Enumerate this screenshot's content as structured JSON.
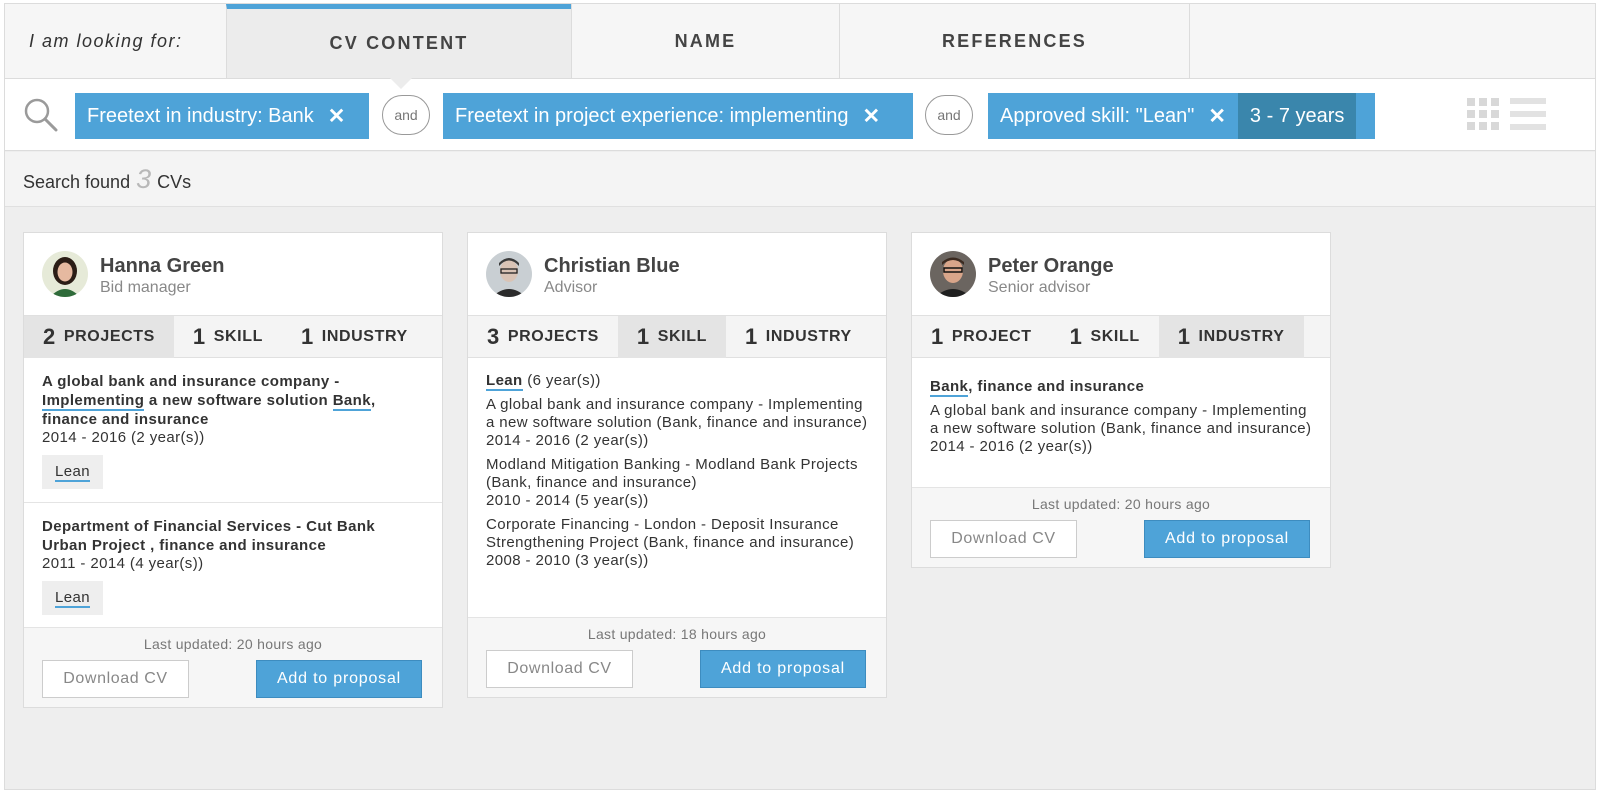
{
  "header": {
    "looking_for": "I am looking for:",
    "tabs": [
      {
        "label": "CV CONTENT",
        "active": true
      },
      {
        "label": "NAME",
        "active": false
      },
      {
        "label": "REFERENCES",
        "active": false
      }
    ]
  },
  "filters": {
    "chips": [
      {
        "label": "Freetext in industry: Bank",
        "remove": "✕"
      },
      {
        "label": "Freetext in project experience: implementing",
        "remove": "✕"
      },
      {
        "label": "Approved skill: \"Lean\"",
        "remove": "✕",
        "extra": "3 - 7 years"
      }
    ],
    "and_label": "and",
    "icons": [
      "search-icon",
      "grid-view-icon",
      "list-view-icon"
    ]
  },
  "results": {
    "prefix": "Search found",
    "count": "3",
    "suffix": "CVs"
  },
  "colors": {
    "accent": "#4ea3d8",
    "accent_dark": "#3a86ac",
    "background": "#eeeeee"
  },
  "cards": [
    {
      "name": "Hanna Green",
      "role": "Bid manager",
      "stats": [
        {
          "n": "2",
          "label": "PROJECTS"
        },
        {
          "n": "1",
          "label": "SKILL"
        },
        {
          "n": "1",
          "label": "INDUSTRY"
        }
      ],
      "projects": [
        {
          "l1": "A global bank and insurance company",
          "sep": "-",
          "hl1": "Implementing",
          "l2": "a new software solution",
          "hl2": "Bank",
          "l3": "finance and insurance",
          "years": "2014 - 2016 (2 year(s))",
          "tag": "Lean"
        },
        {
          "l1": "Department of Financial Services",
          "sep": "-",
          "l2": "Cut Bank Urban Project",
          "hl": "Bank",
          "l3": "finance and insurance",
          "years": "2011 - 2014 (4 year(s))",
          "tag": "Lean"
        }
      ],
      "updated": "Last updated: 20 hours ago",
      "download": "Download CV",
      "add": "Add to proposal"
    },
    {
      "name": "Christian Blue",
      "role": "Advisor",
      "stats": [
        {
          "n": "3",
          "label": "PROJECTS"
        },
        {
          "n": "1",
          "label": "SKILL"
        },
        {
          "n": "1",
          "label": "INDUSTRY"
        }
      ],
      "skill": {
        "name": "Lean",
        "years": "(6 year(s))"
      },
      "entries": [
        {
          "text": "A global bank and insurance company - Implementing a new software solution (Bank, finance and insurance)",
          "years": "2014 - 2016 (2 year(s))"
        },
        {
          "text": "Modland Mitigation Banking - Modland Bank Projects (Bank, finance and insurance)",
          "years": "2010 - 2014 (5 year(s))"
        },
        {
          "text": "Corporate Financing - London - Deposit Insurance Strengthening Project (Bank, finance and insurance)",
          "years": "2008 - 2010 (3 year(s))"
        }
      ],
      "updated": "Last updated: 18 hours ago",
      "download": "Download CV",
      "add": "Add to proposal"
    },
    {
      "name": "Peter Orange",
      "role": "Senior advisor",
      "stats": [
        {
          "n": "1",
          "label": "PROJECT"
        },
        {
          "n": "1",
          "label": "SKILL"
        },
        {
          "n": "1",
          "label": "INDUSTRY"
        }
      ],
      "industry": {
        "hl": "Bank",
        "rest": "finance and insurance"
      },
      "entries": [
        {
          "text": "A global bank and insurance company - Implementing a new software solution (Bank, finance and insurance)",
          "years": "2014 - 2016 (2 year(s))"
        }
      ],
      "updated": "Last updated: 20 hours ago",
      "download": "Download CV",
      "add": "Add to proposal"
    }
  ]
}
